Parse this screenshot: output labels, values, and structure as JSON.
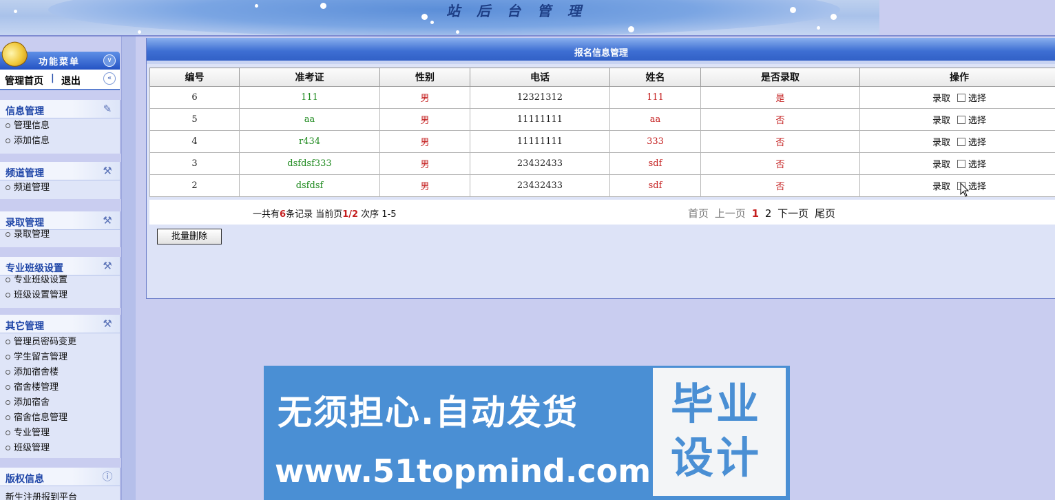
{
  "banner": {
    "title": "站后台管理"
  },
  "sidebar": {
    "menu_title": "功能菜单",
    "links": {
      "home": "管理首页",
      "separator": "|",
      "logout": "退出"
    },
    "sections": [
      {
        "title": "信息管理",
        "icon": "edit-icon",
        "items": [
          "管理信息",
          "添加信息"
        ]
      },
      {
        "title": "频道管理",
        "icon": "tools-icon",
        "items": [
          "频道管理"
        ]
      },
      {
        "title": "录取管理",
        "icon": "tools-icon",
        "items": [
          "录取管理"
        ]
      },
      {
        "title": "专业班级设置",
        "icon": "tools-icon",
        "items": [
          "专业班级设置",
          "班级设置管理"
        ]
      },
      {
        "title": "其它管理",
        "icon": "tools-icon",
        "items": [
          "管理员密码变更",
          "学生留言管理",
          "添加宿舍楼",
          "宿舍楼管理",
          "添加宿舍",
          "宿舍信息管理",
          "专业管理",
          "班级管理"
        ]
      },
      {
        "title": "版权信息",
        "icon": "info-icon",
        "items": [
          "新生注册报到平台"
        ]
      }
    ]
  },
  "main": {
    "title": "报名信息管理",
    "columns": [
      "编号",
      "准考证",
      "性别",
      "电话",
      "姓名",
      "是否录取",
      "操作"
    ],
    "rows": [
      {
        "id": "6",
        "ticket": "111",
        "gender": "男",
        "phone": "12321312",
        "name": "111",
        "admitted": "是"
      },
      {
        "id": "5",
        "ticket": "aa",
        "gender": "男",
        "phone": "11111111",
        "name": "aa",
        "admitted": "否"
      },
      {
        "id": "4",
        "ticket": "r434",
        "gender": "男",
        "phone": "11111111",
        "name": "333",
        "admitted": "否"
      },
      {
        "id": "3",
        "ticket": "dsfdsf333",
        "gender": "男",
        "phone": "23432433",
        "name": "sdf",
        "admitted": "否"
      },
      {
        "id": "2",
        "ticket": "dsfdsf",
        "gender": "男",
        "phone": "23432433",
        "name": "sdf",
        "admitted": "否"
      }
    ],
    "op_accept_label": "录取",
    "op_select_label": "选择",
    "pager": {
      "info_prefix": "一共有",
      "total": "6",
      "info_mid": "条记录 当前页",
      "current": "1/2",
      "info_suffix": " 次序 1-5",
      "first": "首页",
      "prev": "上一页",
      "page1": "1",
      "page2": "2",
      "next": "下一页",
      "last": "尾页"
    },
    "batch_delete": "批量删除"
  },
  "watermark": {
    "line1": "无须担心.自动发货",
    "line2": "www.51topmind.com",
    "badge": "毕业设计"
  }
}
